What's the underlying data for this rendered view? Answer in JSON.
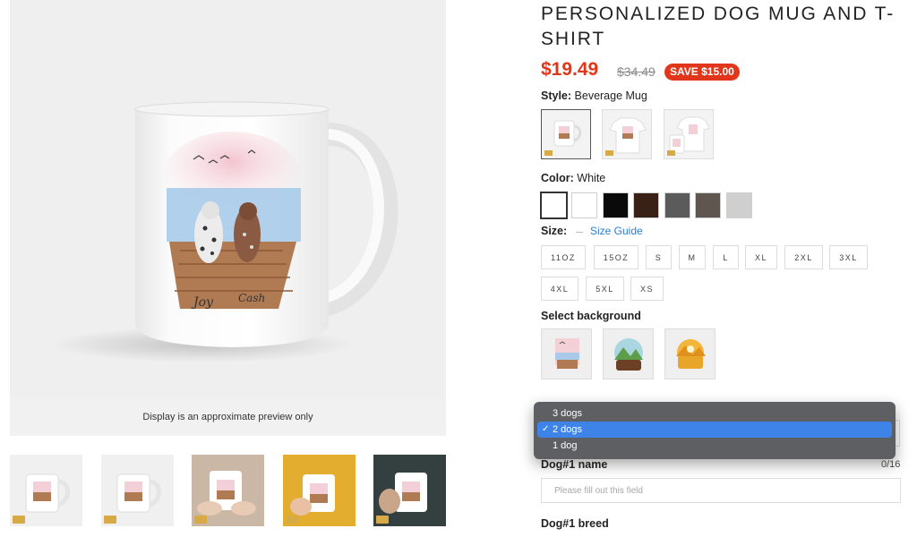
{
  "gallery": {
    "preview_note": "Display is an approximate preview only",
    "mug_names": [
      "Joy",
      "Cash"
    ]
  },
  "product": {
    "title": "PERSONALIZED DOG MUG AND T-SHIRT",
    "price": "$19.49",
    "compare_price": "$34.49",
    "save_badge": "SAVE $15.00"
  },
  "style": {
    "label": "Style:",
    "value": "Beverage Mug",
    "options": [
      "mug",
      "t-shirt",
      "mug-and-t-shirt"
    ]
  },
  "color": {
    "label": "Color:",
    "value": "White",
    "swatches": [
      "#ffffff",
      "#ffffff",
      "#0a0a0a",
      "#3a2116",
      "#5b5b5b",
      "#605650",
      "#cfcfcf"
    ]
  },
  "size": {
    "label": "Size:",
    "guide_label": "Size Guide",
    "options": [
      "11OZ",
      "15OZ",
      "S",
      "M",
      "L",
      "XL",
      "2XL",
      "3XL",
      "4XL",
      "5XL",
      "XS"
    ]
  },
  "background": {
    "label": "Select background",
    "options": [
      "pink-dock",
      "green-mountain",
      "yellow-sunset"
    ]
  },
  "dogs": {
    "options": [
      "3 dogs",
      "2 dogs",
      "1 dog"
    ],
    "selected": "2 dogs",
    "check": "✓"
  },
  "dog1": {
    "name_label": "Dog#1 name",
    "counter": "0/16",
    "placeholder": "Please fill out this field",
    "breed_label": "Dog#1 breed"
  },
  "colors": {
    "accent_red": "#e2361b",
    "link_blue": "#2a7ecf",
    "dropdown_bg": "#5e5f63",
    "dropdown_highlight": "#3e84e8"
  }
}
